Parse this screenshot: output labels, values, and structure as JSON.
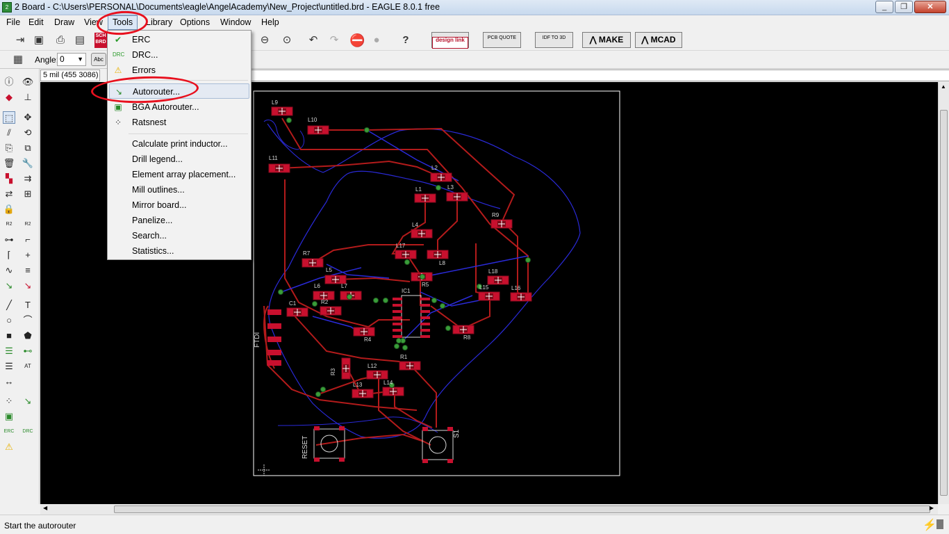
{
  "window": {
    "title": "2 Board - C:\\Users\\PERSONAL\\Documents\\eagle\\AngelAcademy\\New_Project\\untitled.brd - EAGLE 8.0.1 free"
  },
  "menubar": [
    "File",
    "Edit",
    "Draw",
    "View",
    "Tools",
    "Library",
    "Options",
    "Window",
    "Help"
  ],
  "toolbar": {
    "design_link": "design link",
    "pcb_quote": "PCB QUOTE",
    "idf": "IDF TO 3D",
    "make": "MAKE",
    "mcad": "MCAD",
    "sch_brd": "SCH BRD"
  },
  "params": {
    "angle_label": "Angle:",
    "angle_value": "0",
    "abc": "Abc"
  },
  "coord": "5 mil (455 3086)",
  "tools_menu": [
    {
      "label": "ERC",
      "icon": "erc-icon"
    },
    {
      "label": "DRC...",
      "icon": "drc-icon"
    },
    {
      "label": "Errors",
      "icon": "warning-icon"
    },
    {
      "label": "Autorouter...",
      "icon": "autorouter-icon"
    },
    {
      "label": "BGA Autorouter...",
      "icon": "bga-autorouter-icon"
    },
    {
      "label": "Ratsnest",
      "icon": "ratsnest-icon"
    },
    {
      "label": "Calculate print inductor..."
    },
    {
      "label": "Drill legend..."
    },
    {
      "label": "Element array placement..."
    },
    {
      "label": "Mill outlines..."
    },
    {
      "label": "Mirror board..."
    },
    {
      "label": "Panelize..."
    },
    {
      "label": "Search..."
    },
    {
      "label": "Statistics..."
    }
  ],
  "board": {
    "parts": [
      "L9",
      "L10",
      "L11",
      "L2",
      "L1",
      "L3",
      "R9",
      "L4",
      "L17",
      "L8",
      "R5",
      "R7",
      "L5",
      "L6",
      "L7",
      "IC1",
      "L18",
      "L15",
      "L16",
      "C1",
      "R2",
      "FTDI",
      "R4",
      "R8",
      "R1",
      "L12",
      "R3",
      "L13",
      "L14",
      "RESET",
      "S1"
    ]
  },
  "status": "Start the autorouter",
  "colors": {
    "canvas": "#000000",
    "trace_top": "#b31b1b",
    "trace_bottom": "#2a2ad8",
    "pad": "#c8102e",
    "via": "#3a9d3a",
    "outline": "#ffffff",
    "annotation": "#e8101e"
  }
}
